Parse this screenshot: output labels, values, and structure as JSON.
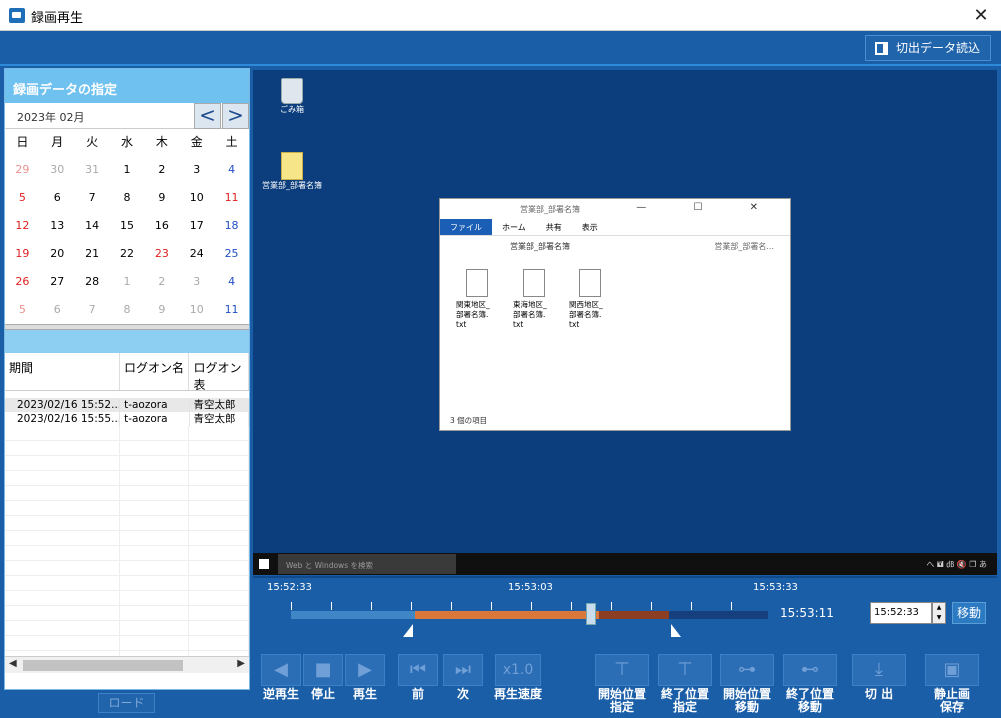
{
  "window": {
    "title": "録画再生",
    "close": "✕"
  },
  "toolbar": {
    "load_cut_label": "切出データ読込"
  },
  "calendar": {
    "header": "録画データの指定",
    "month_label": "2023年 02月",
    "prev": "<",
    "next": ">",
    "weekdays": [
      "日",
      "月",
      "火",
      "水",
      "木",
      "金",
      "土"
    ],
    "weeks": [
      [
        "29",
        "30",
        "31",
        "1",
        "2",
        "3",
        "4"
      ],
      [
        "5",
        "6",
        "7",
        "8",
        "9",
        "10",
        "11"
      ],
      [
        "12",
        "13",
        "14",
        "15",
        "16",
        "17",
        "18"
      ],
      [
        "19",
        "20",
        "21",
        "22",
        "23",
        "24",
        "25"
      ],
      [
        "26",
        "27",
        "28",
        "1",
        "2",
        "3",
        "4"
      ],
      [
        "5",
        "6",
        "7",
        "8",
        "9",
        "10",
        "11"
      ]
    ]
  },
  "log_table": {
    "columns": [
      "期間",
      "ログオン名",
      "ログオン表"
    ],
    "rows": [
      [
        "2023/02/16 15:52...",
        "t-aozora",
        "青空太郎"
      ],
      [
        "2023/02/16 15:55...",
        "t-aozora",
        "青空太郎"
      ]
    ]
  },
  "load_button": "ロード",
  "desktop": {
    "icons": [
      {
        "label": "ごみ箱",
        "icon": "recycle-bin-icon"
      },
      {
        "label": "営業部_部署名簿",
        "icon": "folder-icon"
      }
    ],
    "explorer": {
      "title": "営業部_部署名簿",
      "ribbon_tabs": [
        "ファイル",
        "ホーム",
        "共有",
        "表示"
      ],
      "address": "営業部_部署名簿",
      "search_placeholder": "営業部_部署名... ",
      "files": [
        {
          "line1": "関東地区_",
          "line2": "部署名簿.",
          "line3": "txt"
        },
        {
          "line1": "東海地区_",
          "line2": "部署名簿.",
          "line3": "txt"
        },
        {
          "line1": "関西地区_",
          "line2": "部署名簿.",
          "line3": "txt"
        }
      ],
      "status": "3 個の項目"
    },
    "taskbar": {
      "search_text": "Web と Windows を検索",
      "tray_text": "へ 🖬 ㏈ 🔇 ❐ あ"
    }
  },
  "timeline": {
    "labels": [
      "15:52:33",
      "15:53:03",
      "15:53:33"
    ],
    "current_time": "15:53:11",
    "time_input": "15:52:33",
    "move_label": "移動"
  },
  "controls": [
    {
      "id": "reverse",
      "glyph": "◀",
      "label": "逆再生"
    },
    {
      "id": "stop",
      "glyph": "■",
      "label": "停止"
    },
    {
      "id": "play",
      "glyph": "▶",
      "label": "再生"
    },
    {
      "id": "prev",
      "glyph": "⏮",
      "label": "前"
    },
    {
      "id": "next",
      "glyph": "⏭",
      "label": "次"
    },
    {
      "id": "speed",
      "glyph": "x1.0",
      "label": "再生速度"
    },
    {
      "id": "set-start",
      "glyph": "⊤",
      "label1": "開始位置",
      "label2": "指定"
    },
    {
      "id": "set-end",
      "glyph": "⊤",
      "label1": "終了位置",
      "label2": "指定"
    },
    {
      "id": "goto-start",
      "glyph": "⊶",
      "label1": "開始位置",
      "label2": "移動"
    },
    {
      "id": "goto-end",
      "glyph": "⊷",
      "label1": "終了位置",
      "label2": "移動"
    },
    {
      "id": "cut",
      "glyph": "⤓",
      "label": "切 出"
    },
    {
      "id": "still",
      "glyph": "▣",
      "label1": "静止画",
      "label2": "保存"
    }
  ]
}
